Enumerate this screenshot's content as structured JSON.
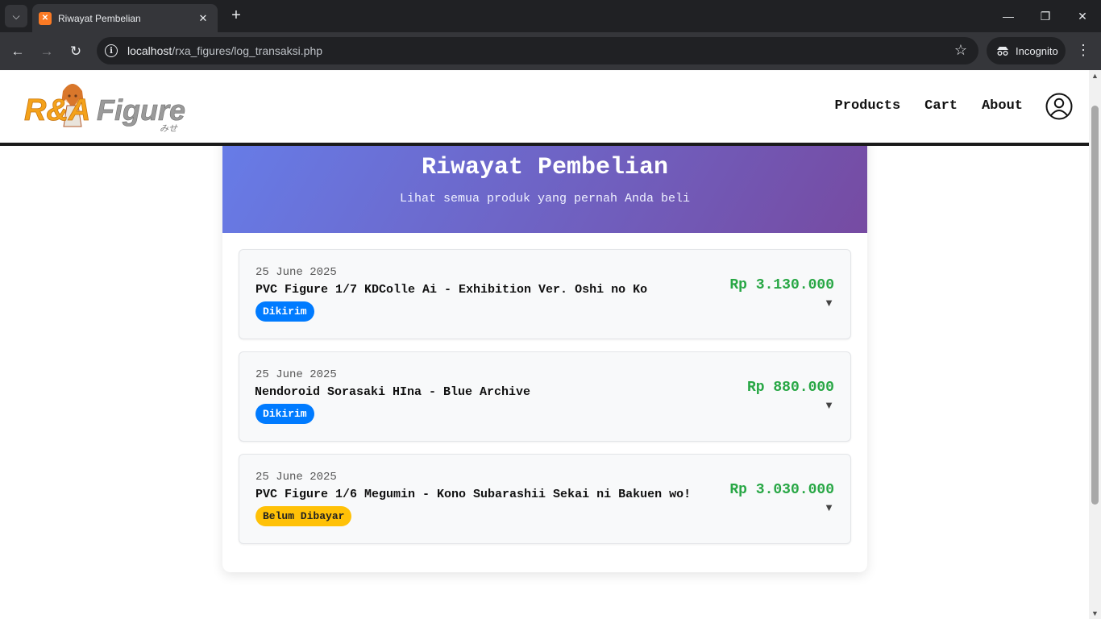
{
  "browser": {
    "tab_title": "Riwayat Pembelian",
    "tab_favicon": "xampp-icon",
    "url_host": "localhost",
    "url_path": "/rxa_figures/log_transaksi.php",
    "incognito_label": "Incognito"
  },
  "site": {
    "logo_text": "R&AFigure",
    "nav": [
      "Products",
      "Cart",
      "About"
    ],
    "account_icon": "user-circle-icon"
  },
  "page": {
    "title": "Riwayat Pembelian",
    "subtitle": "Lihat semua produk yang pernah Anda beli"
  },
  "transactions": [
    {
      "date": "25 June 2025",
      "product": "PVC Figure 1/7 KDColle Ai - Exhibition Ver. Oshi no Ko",
      "status": "Dikirim",
      "price": "Rp 3.130.000",
      "toggle": "▼"
    },
    {
      "date": "25 June 2025",
      "product": "Nendoroid Sorasaki HIna - Blue Archive",
      "status": "Dikirim",
      "price": "Rp 880.000",
      "toggle": "▼"
    },
    {
      "date": "25 June 2025",
      "product": "PVC Figure 1/6 Megumin - Kono Subarashii Sekai ni Bakuen wo!",
      "status": "Belum Dibayar",
      "price": "Rp 3.030.000",
      "toggle": "▼"
    }
  ],
  "colors": {
    "hero_start": "#667eea",
    "hero_end": "#764ba2",
    "price": "#28a745",
    "badge_shipped": "#007bff",
    "badge_unpaid": "#ffc107"
  }
}
